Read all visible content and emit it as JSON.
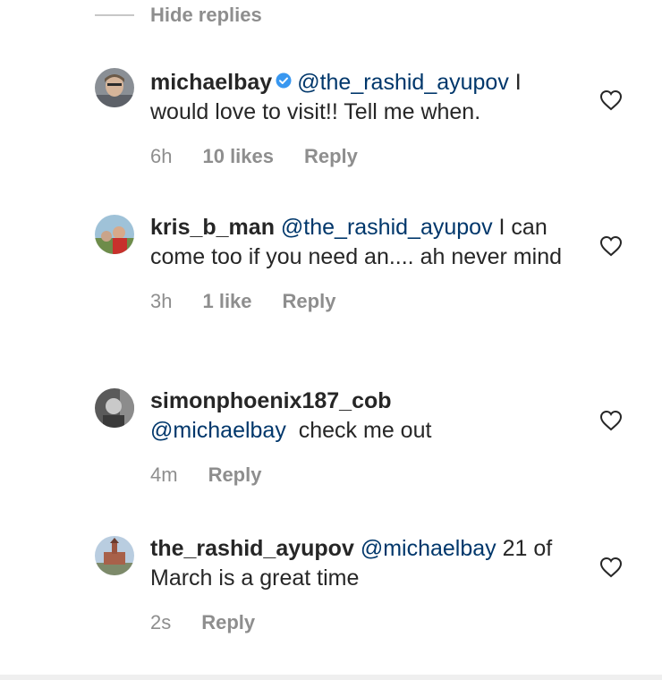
{
  "thread": {
    "hide_replies_label": "Hide replies"
  },
  "comments": [
    {
      "username": "michaelbay",
      "verified": true,
      "mention": "@the_rashid_ayupov",
      "text": " I would love to visit!! Tell me when.",
      "time": "6h",
      "likes": "10 likes",
      "reply_label": "Reply"
    },
    {
      "username": "kris_b_man",
      "verified": false,
      "mention": "@the_rashid_ayupov",
      "text": " I can come too if you need an.... ah never mind",
      "time": "3h",
      "likes": "1 like",
      "reply_label": "Reply"
    },
    {
      "username": "simonphoenix187_cob",
      "verified": false,
      "mention": "@michaelbay",
      "text": " check me out",
      "time": "4m",
      "likes": "",
      "reply_label": "Reply"
    },
    {
      "username": "the_rashid_ayupov",
      "verified": false,
      "mention": "@michaelbay",
      "text": " 21 of March is a great time",
      "time": "2s",
      "likes": "",
      "reply_label": "Reply"
    }
  ],
  "icons": {
    "heart": "heart-outline-icon",
    "verified": "verified-badge-icon"
  },
  "colors": {
    "mention": "#00376b",
    "muted": "#8e8e8e",
    "verified": "#3897f0",
    "text": "#262626"
  }
}
